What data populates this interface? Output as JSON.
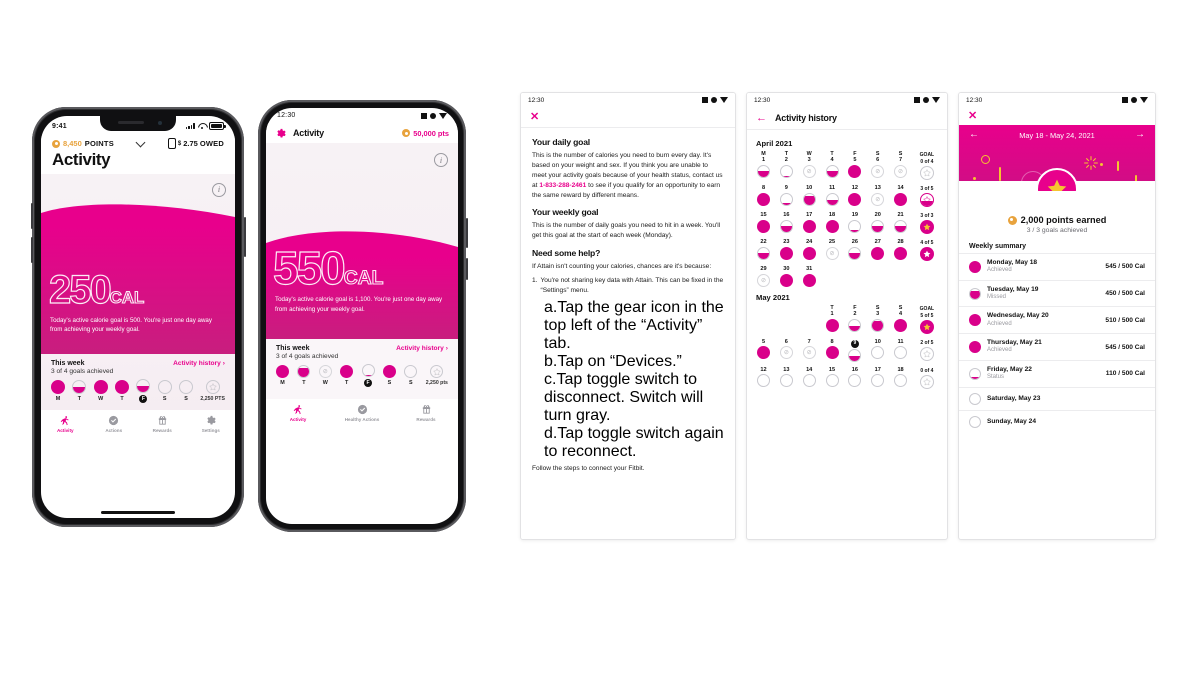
{
  "phone1": {
    "status": {
      "time": "9:41"
    },
    "header": {
      "points_value": "8,450",
      "points_label": "POINTS",
      "owed_value": "2.75",
      "owed_label": "OWED",
      "title": "Activity"
    },
    "hero": {
      "calories": "250",
      "unit": "CAL",
      "copy": "Today's active calorie goal is 500. You're just one day away from achieving your weekly goal.",
      "info_icon": "info-icon"
    },
    "week": {
      "title": "This week",
      "subtitle": "3 of 4 goals achieved",
      "link": "Activity history",
      "points": "2,250 PTS",
      "days": [
        {
          "label": "M",
          "fill": 100,
          "today": false
        },
        {
          "label": "T",
          "fill": 50,
          "today": false
        },
        {
          "label": "W",
          "fill": 100,
          "today": false
        },
        {
          "label": "T",
          "fill": 100,
          "today": false
        },
        {
          "label": "F",
          "fill": 50,
          "today": true
        },
        {
          "label": "S",
          "fill": 0,
          "today": false
        },
        {
          "label": "S",
          "fill": 0,
          "today": false
        }
      ]
    },
    "tabs": [
      {
        "label": "Activity",
        "icon": "runner-icon",
        "active": true
      },
      {
        "label": "Actions",
        "icon": "check-circle-icon",
        "active": false
      },
      {
        "label": "Rewards",
        "icon": "gift-icon",
        "active": false
      },
      {
        "label": "Settings",
        "icon": "gear-icon",
        "active": false
      }
    ]
  },
  "phone2": {
    "status": {
      "time": "12:30"
    },
    "header": {
      "gear_icon": "gear-icon",
      "title": "Activity",
      "points": "50,000 pts"
    },
    "hero": {
      "calories": "550",
      "unit": "CAL",
      "copy": "Today's active calorie goal is 1,100. You're just one day away from achieving your weekly goal.",
      "info_icon": "info-icon"
    },
    "week": {
      "title": "This week",
      "subtitle": "3 of 4 goals achieved",
      "link": "Activity history",
      "points": "2,250 pts",
      "days": [
        {
          "label": "M",
          "fill": 100,
          "today": false,
          "nodata": false
        },
        {
          "label": "T",
          "fill": 85,
          "today": false,
          "nodata": false
        },
        {
          "label": "W",
          "fill": 0,
          "today": false,
          "nodata": true
        },
        {
          "label": "T",
          "fill": 100,
          "today": false,
          "nodata": false
        },
        {
          "label": "F",
          "fill": 12,
          "today": true,
          "nodata": false
        },
        {
          "label": "S",
          "fill": 100,
          "today": false,
          "nodata": false
        },
        {
          "label": "S",
          "fill": 0,
          "today": false,
          "nodata": false
        }
      ]
    },
    "tabs": [
      {
        "label": "Activity",
        "icon": "runner-icon",
        "active": true
      },
      {
        "label": "Healthy Actions",
        "icon": "check-circle-icon",
        "active": false
      },
      {
        "label": "Rewards",
        "icon": "gift-icon",
        "active": false
      }
    ]
  },
  "panel_help": {
    "status": {
      "time": "12:30"
    },
    "close_icon": "close-icon",
    "sections": [
      {
        "heading": "Your daily goal",
        "body_before": "This is the number of calories you need to burn every day. It's based on your weight and sex. If you think you are unable to meet your activity goals because of your health status, contact us at ",
        "phone": "1-833-288-2461",
        "body_after": " to see if you qualify for an opportunity to earn the same reward by different means."
      },
      {
        "heading": "Your weekly goal",
        "body": "This is the number of daily goals you need to hit in a week. You'll get this goal at the start of each week (Monday)."
      }
    ],
    "help_heading": "Need some help?",
    "help_intro": "If Attain isn't counting your calories, chances are it's because:",
    "items": [
      {
        "mark": "1.",
        "text": "You're not sharing key data with Attain. This can be fixed in the “Settings” menu."
      }
    ],
    "sub_items": [
      {
        "mark": "a.",
        "text": "Tap the gear icon in the top left of the “Activity” tab."
      },
      {
        "mark": "b.",
        "text": "Tap on “Devices.”"
      },
      {
        "mark": "c.",
        "text": "Tap toggle switch to disconnect. Switch will turn gray."
      },
      {
        "mark": "d.",
        "text": "Tap toggle switch again to reconnect."
      }
    ],
    "cutoff_text": "Follow the steps to connect your Fitbit."
  },
  "panel_history": {
    "status": {
      "time": "12:30"
    },
    "back_icon": "back-arrow-icon",
    "title": "Activity history",
    "months": [
      {
        "name": "April 2021",
        "dow": [
          "M",
          "T",
          "W",
          "T",
          "F",
          "S",
          "S"
        ],
        "goal_header": "GOAL",
        "weeks": [
          {
            "goal": "0 of 4",
            "star": "empty",
            "days": [
              {
                "num": "1",
                "fill": 55,
                "nodata": false
              },
              {
                "num": "2",
                "fill": 12,
                "nodata": false
              },
              {
                "num": "3",
                "fill": 0,
                "nodata": true
              },
              {
                "num": "4",
                "fill": 55,
                "nodata": false
              },
              {
                "num": "5",
                "fill": 100,
                "nodata": false
              },
              {
                "num": "6",
                "fill": 0,
                "nodata": true
              },
              {
                "num": "7",
                "fill": 0,
                "nodata": true
              }
            ]
          },
          {
            "goal": "3 of 5",
            "star": "half",
            "days": [
              {
                "num": "8",
                "fill": 100,
                "nodata": false
              },
              {
                "num": "9",
                "fill": 12,
                "nodata": false
              },
              {
                "num": "10",
                "fill": 75,
                "nodata": false
              },
              {
                "num": "11",
                "fill": 45,
                "nodata": false
              },
              {
                "num": "12",
                "fill": 100,
                "nodata": false
              },
              {
                "num": "13",
                "fill": 0,
                "nodata": true
              },
              {
                "num": "14",
                "fill": 100,
                "nodata": false
              }
            ]
          },
          {
            "goal": "3 of 3",
            "star": "full",
            "days": [
              {
                "num": "15",
                "fill": 100,
                "nodata": false
              },
              {
                "num": "16",
                "fill": 50,
                "nodata": false
              },
              {
                "num": "17",
                "fill": 100,
                "nodata": false
              },
              {
                "num": "18",
                "fill": 100,
                "nodata": false
              },
              {
                "num": "19",
                "fill": 12,
                "nodata": false
              },
              {
                "num": "20",
                "fill": 50,
                "nodata": false
              },
              {
                "num": "21",
                "fill": 50,
                "nodata": false
              }
            ]
          },
          {
            "goal": "4 of 5",
            "star": "outline-on-fill",
            "days": [
              {
                "num": "22",
                "fill": 55,
                "nodata": false
              },
              {
                "num": "23",
                "fill": 100,
                "nodata": false
              },
              {
                "num": "24",
                "fill": 100,
                "nodata": false
              },
              {
                "num": "25",
                "fill": 0,
                "nodata": true
              },
              {
                "num": "26",
                "fill": 50,
                "nodata": false
              },
              {
                "num": "27",
                "fill": 100,
                "nodata": false
              },
              {
                "num": "28",
                "fill": 100,
                "nodata": false
              }
            ]
          },
          {
            "goal": "",
            "star": "none",
            "days": [
              {
                "num": "29",
                "fill": 0,
                "nodata": true
              },
              {
                "num": "30",
                "fill": 100,
                "nodata": false
              },
              {
                "num": "31",
                "fill": 100,
                "nodata": false
              }
            ]
          }
        ]
      },
      {
        "name": "May 2021",
        "dow": [
          "T",
          "F",
          "S",
          "S"
        ],
        "goal_header": "GOAL",
        "weeks": [
          {
            "goal": "5 of 5",
            "star": "full",
            "offset": 3,
            "days": [
              {
                "num": "1",
                "fill": 100,
                "nodata": false
              },
              {
                "num": "2",
                "fill": 45,
                "nodata": false
              },
              {
                "num": "3",
                "fill": 85,
                "nodata": false
              },
              {
                "num": "4",
                "fill": 100,
                "nodata": false
              }
            ]
          },
          {
            "goal": "2 of 5",
            "star": "empty",
            "offset": 0,
            "days": [
              {
                "num": "5",
                "fill": 100,
                "nodata": false
              },
              {
                "num": "6",
                "fill": 0,
                "nodata": true
              },
              {
                "num": "7",
                "fill": 0,
                "nodata": true
              },
              {
                "num": "8",
                "fill": 100,
                "nodata": false
              },
              {
                "num": "9",
                "fill": 45,
                "nodata": false,
                "today": true
              },
              {
                "num": "10",
                "fill": 0,
                "nodata": false
              },
              {
                "num": "11",
                "fill": 0,
                "nodata": false
              }
            ]
          },
          {
            "goal": "0 of 4",
            "star": "empty",
            "offset": 0,
            "days": [
              {
                "num": "12",
                "fill": 0,
                "nodata": false
              },
              {
                "num": "13",
                "fill": 0,
                "nodata": false
              },
              {
                "num": "14",
                "fill": 0,
                "nodata": false
              },
              {
                "num": "15",
                "fill": 0,
                "nodata": false
              },
              {
                "num": "16",
                "fill": 0,
                "nodata": false
              },
              {
                "num": "17",
                "fill": 0,
                "nodata": false
              },
              {
                "num": "18",
                "fill": 0,
                "nodata": false
              }
            ]
          }
        ]
      }
    ]
  },
  "panel_summary": {
    "status": {
      "time": "12:30"
    },
    "close_icon": "close-icon",
    "banner": {
      "prev_icon": "left-arrow-icon",
      "range": "May 18 - May 24, 2021",
      "next_icon": "right-arrow-icon",
      "star_icon": "star-icon"
    },
    "points_earned": "2,000 points earned",
    "goals_achieved": "3 / 3 goals achieved",
    "summary_heading": "Weekly summary",
    "rows": [
      {
        "day": "Monday, May 18",
        "status": "Achieved",
        "value": "545 / 500 Cal",
        "fill": 100
      },
      {
        "day": "Tuesday, May 19",
        "status": "Missed",
        "value": "450 / 500 Cal",
        "fill": 80
      },
      {
        "day": "Wednesday, May 20",
        "status": "Achieved",
        "value": "510 / 500 Cal",
        "fill": 100
      },
      {
        "day": "Thursday, May 21",
        "status": "Achieved",
        "value": "545 / 500 Cal",
        "fill": 100
      },
      {
        "day": "Friday, May 22",
        "status": "Status",
        "value": "110 / 500 Cal",
        "fill": 18
      },
      {
        "day": "Saturday, May 23",
        "status": "",
        "value": "",
        "fill": 0
      },
      {
        "day": "Sunday, May 24",
        "status": "",
        "value": "",
        "fill": 0
      }
    ]
  },
  "colors": {
    "magenta": "#E8008C",
    "magenta_dark": "#C81E7E",
    "gold": "#E8A33D",
    "star_yellow": "#F5C430",
    "grey_text": "#9a9aa0"
  }
}
